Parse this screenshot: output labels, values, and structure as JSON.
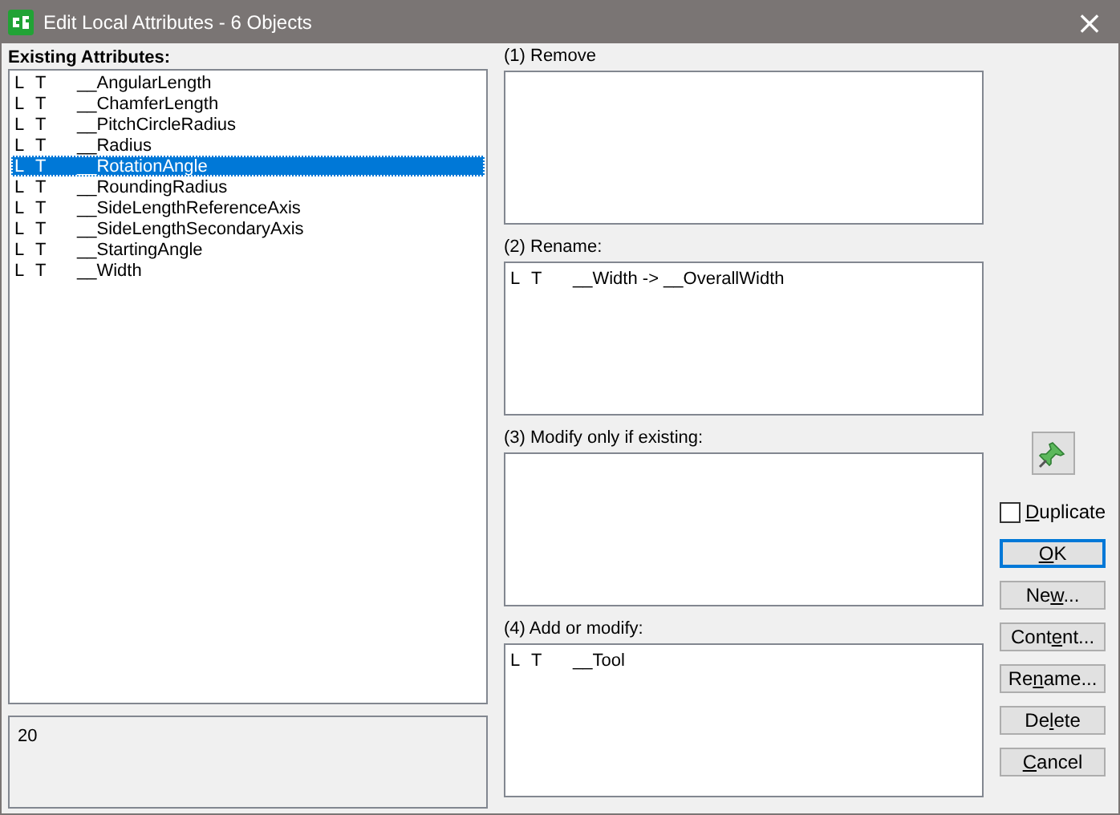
{
  "window": {
    "title": "Edit Local Attributes - 6 Objects",
    "close": "×"
  },
  "existing": {
    "label": "Existing Attributes:",
    "rows": [
      {
        "flag_1": "L",
        "flag_2": "T",
        "name": "__AngularLength",
        "selected": false
      },
      {
        "flag_1": "L",
        "flag_2": "T",
        "name": "__ChamferLength",
        "selected": false
      },
      {
        "flag_1": "L",
        "flag_2": "T",
        "name": "__PitchCircleRadius",
        "selected": false
      },
      {
        "flag_1": "L",
        "flag_2": "T",
        "name": "__Radius",
        "selected": false
      },
      {
        "flag_1": "L",
        "flag_2": "T",
        "name": "__RotationAngle",
        "selected": true
      },
      {
        "flag_1": "L",
        "flag_2": "T",
        "name": "__RoundingRadius",
        "selected": false
      },
      {
        "flag_1": "L",
        "flag_2": "T",
        "name": "__SideLengthReferenceAxis",
        "selected": false
      },
      {
        "flag_1": "L",
        "flag_2": "T",
        "name": "__SideLengthSecondaryAxis",
        "selected": false
      },
      {
        "flag_1": "L",
        "flag_2": "T",
        "name": "__StartingAngle",
        "selected": false
      },
      {
        "flag_1": "L",
        "flag_2": "T",
        "name": "__Width",
        "selected": false
      }
    ],
    "value": "20"
  },
  "sections": [
    {
      "label": "(1) Remove"
    },
    {
      "label": "(2) Rename:",
      "rows": [
        {
          "flag_1": "L",
          "flag_2": "T",
          "name": "__Width -> __OverallWidth"
        }
      ]
    },
    {
      "label": "(3) Modify only if existing:"
    },
    {
      "label": "(4) Add or modify:",
      "rows": [
        {
          "flag_1": "L",
          "flag_2": "T",
          "name": "__Tool"
        }
      ]
    }
  ],
  "duplicate": {
    "label": {
      "key": "D",
      "after": "uplicate"
    },
    "checked": false
  },
  "buttons": [
    {
      "label": {
        "key": "O",
        "after": "K"
      },
      "default": true
    },
    {
      "label": {
        "before": "Ne",
        "key": "w",
        "after": "..."
      },
      "default": false
    },
    {
      "label": {
        "before": "Cont",
        "key": "e",
        "after": "nt..."
      },
      "default": false
    },
    {
      "label": {
        "before": "Re",
        "key": "n",
        "after": "ame..."
      },
      "default": false
    },
    {
      "label": {
        "before": "De",
        "key": "l",
        "after": "ete"
      },
      "default": false
    },
    {
      "label": {
        "key": "C",
        "after": "ancel"
      },
      "default": false
    }
  ]
}
